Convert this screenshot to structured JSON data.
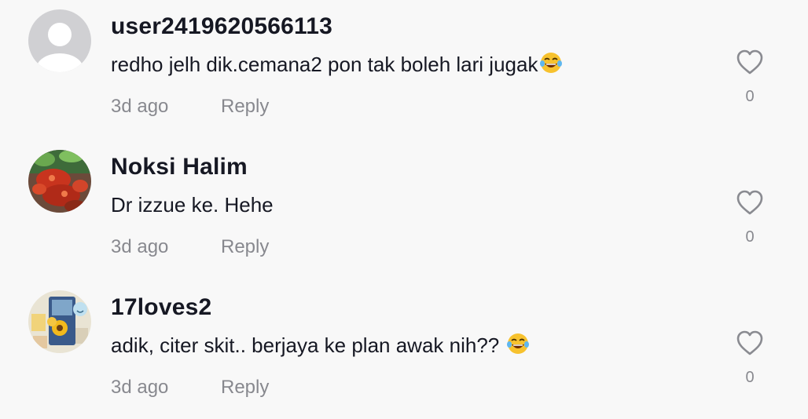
{
  "comments": [
    {
      "username": "user2419620566113",
      "text": "redho jelh dik.cemana2 pon tak boleh lari jugak",
      "emoji": "tears-of-joy",
      "time": "3d ago",
      "reply_label": "Reply",
      "likes": "0",
      "avatar": "default-avatar"
    },
    {
      "username": "Noksi Halim",
      "text": "Dr izzue ke. Hehe",
      "time": "3d ago",
      "reply_label": "Reply",
      "likes": "0",
      "avatar": "crab-photo"
    },
    {
      "username": "17loves2",
      "text": "adik, citer skit.. berjaya ke plan awak nih?? ",
      "emoji": "tears-of-joy",
      "time": "3d ago",
      "reply_label": "Reply",
      "likes": "0",
      "avatar": "sunflower-collage"
    }
  ],
  "colors": {
    "background": "#f8f8f8",
    "text": "#161823",
    "secondary": "#8a8b91"
  }
}
